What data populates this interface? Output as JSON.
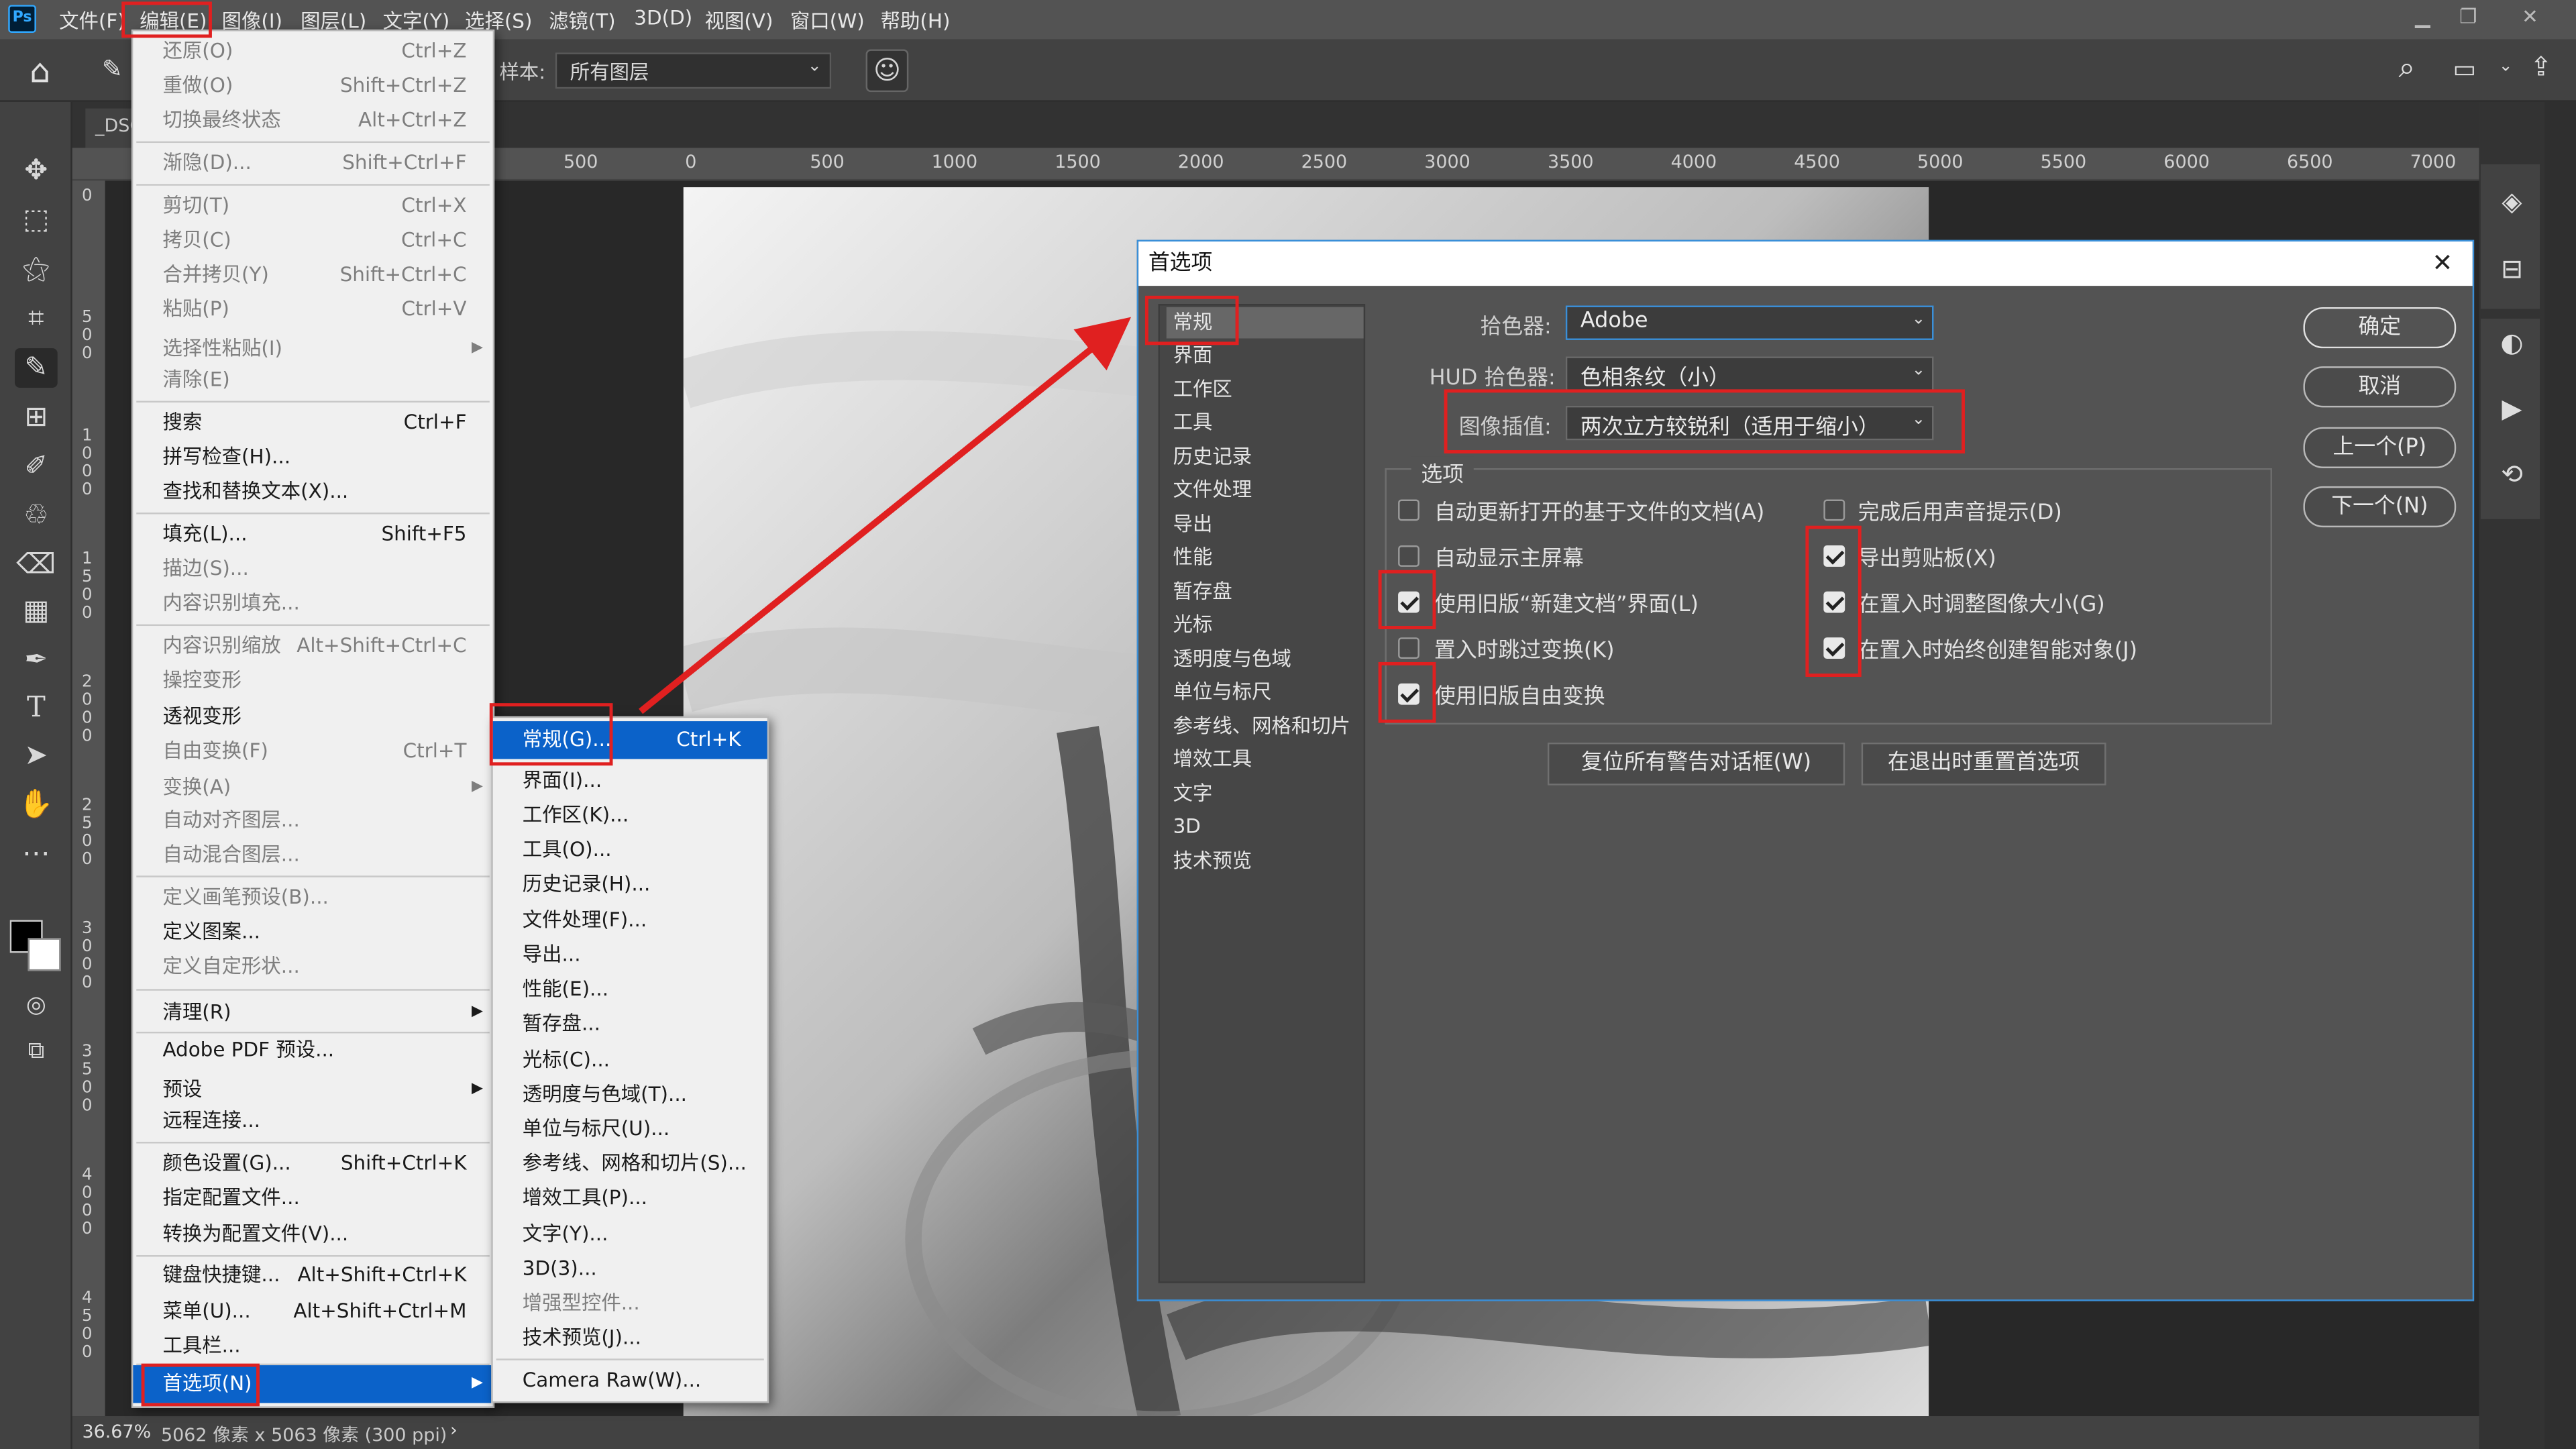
{
  "menubar": {
    "items": [
      "文件(F)",
      "编辑(E)",
      "图像(I)",
      "图层(L)",
      "文字(Y)",
      "选择(S)",
      "滤镜(T)",
      "3D(D)",
      "视图(V)",
      "窗口(W)",
      "帮助(H)"
    ]
  },
  "options_bar": {
    "sample_label": "样本:",
    "sample_value": "所有图层"
  },
  "document": {
    "tab_label": "_DSC",
    "zoom": "36.67%",
    "info": "5062 像素 x 5063 像素 (300 ppi)"
  },
  "ruler_h": [
    "500",
    "0",
    "500",
    "1000",
    "1500",
    "2000",
    "2500",
    "3000",
    "3500",
    "4000",
    "4500",
    "5000",
    "5500",
    "6000",
    "6500",
    "7000"
  ],
  "ruler_v": [
    "0",
    "5 0 0",
    "1 0 0 0",
    "1 5 0 0",
    "2 0 0 0",
    "2 5 0 0",
    "3 0 0 0",
    "3 5 0 0",
    "4 0 0 0",
    "4 5 0 0"
  ],
  "edit_menu": {
    "items": [
      {
        "label": "还原(O)",
        "shortcut": "Ctrl+Z",
        "disabled": true
      },
      {
        "label": "重做(O)",
        "shortcut": "Shift+Ctrl+Z",
        "disabled": true
      },
      {
        "label": "切换最终状态",
        "shortcut": "Alt+Ctrl+Z",
        "disabled": true
      },
      {
        "label": "渐隐(D)...",
        "shortcut": "Shift+Ctrl+F",
        "disabled": true
      },
      {
        "label": "剪切(T)",
        "shortcut": "Ctrl+X",
        "disabled": true
      },
      {
        "label": "拷贝(C)",
        "shortcut": "Ctrl+C",
        "disabled": true
      },
      {
        "label": "合并拷贝(Y)",
        "shortcut": "Shift+Ctrl+C",
        "disabled": true
      },
      {
        "label": "粘贴(P)",
        "shortcut": "Ctrl+V",
        "disabled": true
      },
      {
        "label": "选择性粘贴(I)",
        "shortcut": "",
        "disabled": true
      },
      {
        "label": "清除(E)",
        "shortcut": "",
        "disabled": true
      },
      {
        "label": "搜索",
        "shortcut": "Ctrl+F",
        "disabled": false
      },
      {
        "label": "拼写检查(H)...",
        "shortcut": "",
        "disabled": false
      },
      {
        "label": "查找和替换文本(X)...",
        "shortcut": "",
        "disabled": false
      },
      {
        "label": "填充(L)...",
        "shortcut": "Shift+F5",
        "disabled": false
      },
      {
        "label": "描边(S)...",
        "shortcut": "",
        "disabled": true
      },
      {
        "label": "内容识别填充...",
        "shortcut": "",
        "disabled": true
      },
      {
        "label": "内容识别缩放",
        "shortcut": "Alt+Shift+Ctrl+C",
        "disabled": true
      },
      {
        "label": "操控变形",
        "shortcut": "",
        "disabled": true
      },
      {
        "label": "透视变形",
        "shortcut": "",
        "disabled": false
      },
      {
        "label": "自由变换(F)",
        "shortcut": "Ctrl+T",
        "disabled": true
      },
      {
        "label": "变换(A)",
        "shortcut": "",
        "disabled": true
      },
      {
        "label": "自动对齐图层...",
        "shortcut": "",
        "disabled": true
      },
      {
        "label": "自动混合图层...",
        "shortcut": "",
        "disabled": true
      },
      {
        "label": "定义画笔预设(B)...",
        "shortcut": "",
        "disabled": true
      },
      {
        "label": "定义图案...",
        "shortcut": "",
        "disabled": false
      },
      {
        "label": "定义自定形状...",
        "shortcut": "",
        "disabled": true
      },
      {
        "label": "清理(R)",
        "shortcut": "",
        "disabled": false
      },
      {
        "label": "Adobe PDF 预设...",
        "shortcut": "",
        "disabled": false
      },
      {
        "label": "预设",
        "shortcut": "",
        "disabled": false
      },
      {
        "label": "远程连接...",
        "shortcut": "",
        "disabled": false
      },
      {
        "label": "颜色设置(G)...",
        "shortcut": "Shift+Ctrl+K",
        "disabled": false
      },
      {
        "label": "指定配置文件...",
        "shortcut": "",
        "disabled": false
      },
      {
        "label": "转换为配置文件(V)...",
        "shortcut": "",
        "disabled": false
      },
      {
        "label": "键盘快捷键...",
        "shortcut": "Alt+Shift+Ctrl+K",
        "disabled": false
      },
      {
        "label": "菜单(U)...",
        "shortcut": "Alt+Shift+Ctrl+M",
        "disabled": false
      },
      {
        "label": "工具栏...",
        "shortcut": "",
        "disabled": false
      },
      {
        "label": "首选项(N)",
        "shortcut": "",
        "disabled": false
      }
    ]
  },
  "prefs_submenu": {
    "items": [
      {
        "label": "常规(G)...",
        "shortcut": "Ctrl+K",
        "disabled": false
      },
      {
        "label": "界面(I)...",
        "shortcut": "",
        "disabled": false
      },
      {
        "label": "工作区(K)...",
        "shortcut": "",
        "disabled": false
      },
      {
        "label": "工具(O)...",
        "shortcut": "",
        "disabled": false
      },
      {
        "label": "历史记录(H)...",
        "shortcut": "",
        "disabled": false
      },
      {
        "label": "文件处理(F)...",
        "shortcut": "",
        "disabled": false
      },
      {
        "label": "导出...",
        "shortcut": "",
        "disabled": false
      },
      {
        "label": "性能(E)...",
        "shortcut": "",
        "disabled": false
      },
      {
        "label": "暂存盘...",
        "shortcut": "",
        "disabled": false
      },
      {
        "label": "光标(C)...",
        "shortcut": "",
        "disabled": false
      },
      {
        "label": "透明度与色域(T)...",
        "shortcut": "",
        "disabled": false
      },
      {
        "label": "单位与标尺(U)...",
        "shortcut": "",
        "disabled": false
      },
      {
        "label": "参考线、网格和切片(S)...",
        "shortcut": "",
        "disabled": false
      },
      {
        "label": "增效工具(P)...",
        "shortcut": "",
        "disabled": false
      },
      {
        "label": "文字(Y)...",
        "shortcut": "",
        "disabled": false
      },
      {
        "label": "3D(3)...",
        "shortcut": "",
        "disabled": false
      },
      {
        "label": "增强型控件...",
        "shortcut": "",
        "disabled": true
      },
      {
        "label": "技术预览(J)...",
        "shortcut": "",
        "disabled": false
      },
      {
        "label": "Camera Raw(W)...",
        "shortcut": "",
        "disabled": false
      }
    ]
  },
  "dialog": {
    "title": "首选项",
    "categories": [
      "常规",
      "界面",
      "工作区",
      "工具",
      "历史记录",
      "文件处理",
      "导出",
      "性能",
      "暂存盘",
      "光标",
      "透明度与色域",
      "单位与标尺",
      "参考线、网格和切片",
      "增效工具",
      "文字",
      "3D",
      "技术预览"
    ],
    "color_picker_label": "拾色器:",
    "color_picker_value": "Adobe",
    "hud_label": "HUD 拾色器:",
    "hud_value": "色相条纹（小）",
    "interp_label": "图像插值:",
    "interp_value": "两次立方较锐利（适用于缩小）",
    "options_label": "选项",
    "checkboxes_left": [
      {
        "label": "自动更新打开的基于文件的文档(A)",
        "checked": false
      },
      {
        "label": "自动显示主屏幕",
        "checked": false
      },
      {
        "label": "使用旧版“新建文档”界面(L)",
        "checked": true
      },
      {
        "label": "置入时跳过变换(K)",
        "checked": false
      },
      {
        "label": "使用旧版自由变换",
        "checked": true
      }
    ],
    "checkboxes_right": [
      {
        "label": "完成后用声音提示(D)",
        "checked": false
      },
      {
        "label": "导出剪贴板(X)",
        "checked": true
      },
      {
        "label": "在置入时调整图像大小(G)",
        "checked": true
      },
      {
        "label": "在置入时始终创建智能对象(J)",
        "checked": true
      }
    ],
    "reset_warnings": "复位所有警告对话框(W)",
    "reset_prefs": "在退出时重置首选项",
    "ok": "确定",
    "cancel": "取消",
    "prev": "上一个(P)",
    "next": "下一个(N)"
  },
  "colors": {
    "highlight": "#0b62c9",
    "annotation_red": "#e02020"
  }
}
